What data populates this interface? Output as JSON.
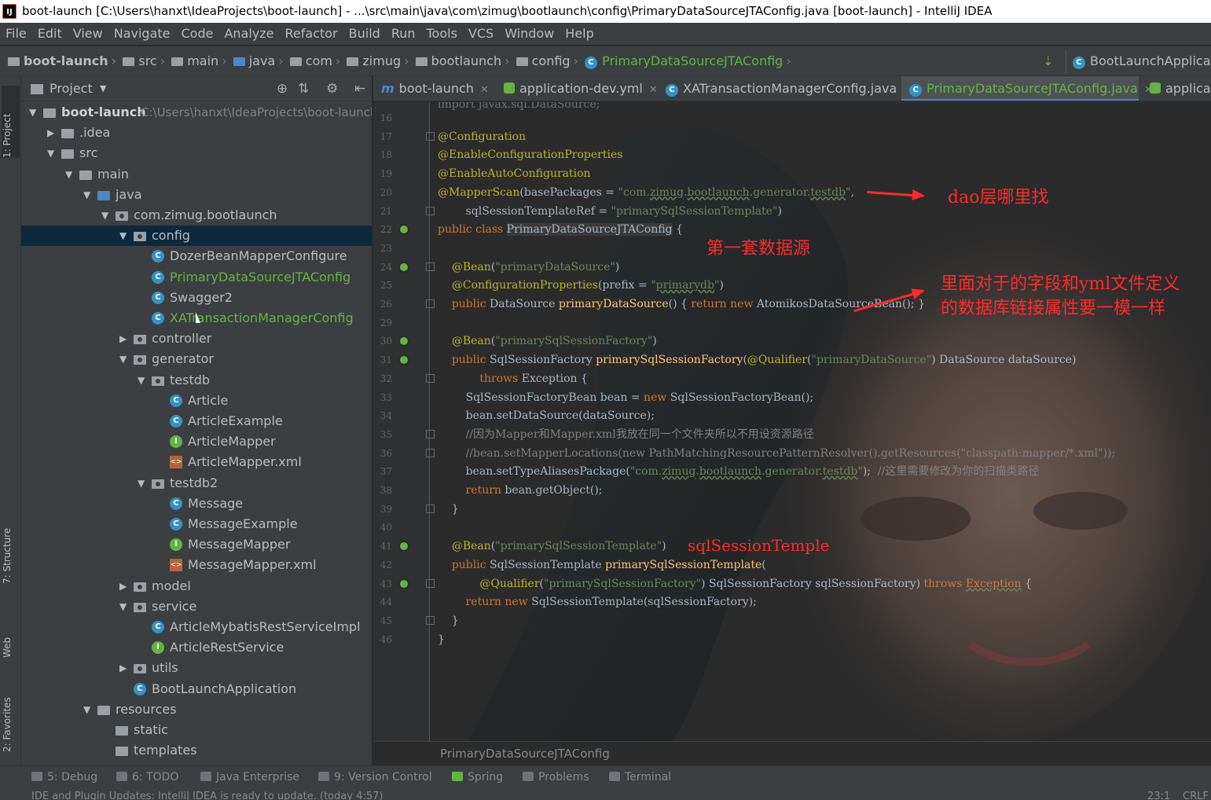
{
  "window": {
    "title": "boot-launch [C:\\Users\\hanxt\\IdeaProjects\\boot-launch] - ...\\src\\main\\java\\com\\zimug\\bootlaunch\\config\\PrimaryDataSourceJTAConfig.java [boot-launch] - IntelliJ IDEA",
    "app_icon_text": "IJ"
  },
  "menu": [
    "File",
    "Edit",
    "View",
    "Navigate",
    "Code",
    "Analyze",
    "Refactor",
    "Build",
    "Run",
    "Tools",
    "VCS",
    "Window",
    "Help"
  ],
  "navbar": {
    "crumbs": [
      "boot-launch",
      "src",
      "main",
      "java",
      "com",
      "zimug",
      "bootlaunch",
      "config",
      "PrimaryDataSourceJTAConfig"
    ],
    "run_config": "BootLaunchApplicatio"
  },
  "leftstrip": {
    "project": "1: Project",
    "structure": "7: Structure",
    "web": "Web",
    "favorites": "2: Favorites"
  },
  "project_panel": {
    "title": "Project",
    "tree": [
      {
        "label": "boot-launch",
        "path": "C:\\Users\\hanxt\\IdeaProjects\\boot-launch"
      },
      {
        "label": ".idea"
      },
      {
        "label": "src"
      },
      {
        "label": "main"
      },
      {
        "label": "java"
      },
      {
        "label": "com.zimug.bootlaunch"
      },
      {
        "label": "config"
      },
      {
        "label": "DozerBeanMapperConfigure"
      },
      {
        "label": "PrimaryDataSourceJTAConfig"
      },
      {
        "label": "Swagger2"
      },
      {
        "label": "XATransactionManagerConfig"
      },
      {
        "label": "controller"
      },
      {
        "label": "generator"
      },
      {
        "label": "testdb"
      },
      {
        "label": "Article"
      },
      {
        "label": "ArticleExample"
      },
      {
        "label": "ArticleMapper"
      },
      {
        "label": "ArticleMapper.xml"
      },
      {
        "label": "testdb2"
      },
      {
        "label": "Message"
      },
      {
        "label": "MessageExample"
      },
      {
        "label": "MessageMapper"
      },
      {
        "label": "MessageMapper.xml"
      },
      {
        "label": "model"
      },
      {
        "label": "service"
      },
      {
        "label": "ArticleMybatisRestServiceImpl"
      },
      {
        "label": "ArticleRestService"
      },
      {
        "label": "utils"
      },
      {
        "label": "BootLaunchApplication"
      },
      {
        "label": "resources"
      },
      {
        "label": "static"
      },
      {
        "label": "templates"
      }
    ]
  },
  "editor": {
    "tabs": [
      "boot-launch",
      "application-dev.yml",
      "XATransactionManagerConfig.java",
      "PrimaryDataSourceJTAConfig.java",
      "applicat"
    ],
    "active_tab": "PrimaryDataSourceJTAConfig.java",
    "breadcrumb": "PrimaryDataSourceJTAConfig",
    "line_numbers": [
      "16",
      "17",
      "18",
      "19",
      "20",
      "21",
      "22",
      "23",
      "24",
      "25",
      "26",
      "29",
      "30",
      "31",
      "32",
      "33",
      "34",
      "35",
      "36",
      "37",
      "38",
      "39",
      "40",
      "41",
      "42",
      "43",
      "44",
      "45",
      "46"
    ],
    "top_partial": "import javax.sql.DataSource;"
  },
  "annotations": {
    "dao": "dao层哪里找",
    "first_ds": "第一套数据源",
    "fields_line1": "里面对于的字段和yml文件定义",
    "fields_line2": "的数据库链接属性要一模一样",
    "template": "sqlSessionTemple"
  },
  "bottom_tools": [
    "5: Debug",
    "6: TODO",
    "Java Enterprise",
    "9: Version Control",
    "Spring",
    "Problems",
    "Terminal"
  ],
  "status": {
    "message": "IDE and Plugin Updates: IntelliJ IDEA is ready to update. (today 4:57)",
    "position": "23:1",
    "line_sep": "CRLF"
  },
  "colors": {
    "accent": "#4a88c7",
    "green": "#62b543",
    "annotation_red": "#ff2a2a"
  }
}
